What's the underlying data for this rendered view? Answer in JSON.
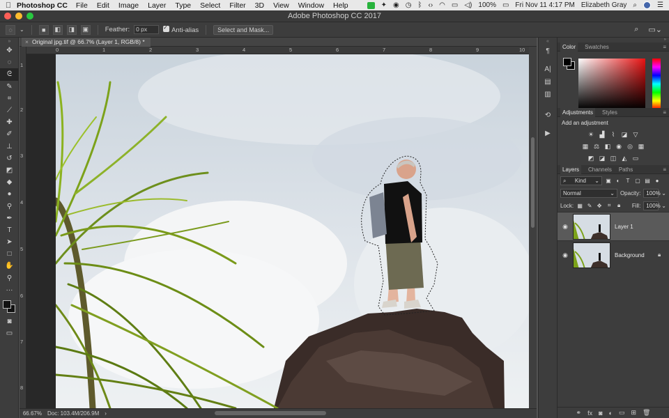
{
  "menubar": {
    "app_name": "Photoshop CC",
    "items": [
      "File",
      "Edit",
      "Image",
      "Layer",
      "Type",
      "Select",
      "Filter",
      "3D",
      "View",
      "Window",
      "Help"
    ],
    "battery": "100%",
    "datetime": "Fri Nov 11  4:17 PM",
    "user": "Elizabeth Gray"
  },
  "window": {
    "title": "Adobe Photoshop CC 2017"
  },
  "options_bar": {
    "feather_label": "Feather:",
    "feather_value": "0 px",
    "antialias_label": "Anti-alias",
    "antialias_checked": true,
    "select_mask_label": "Select and Mask..."
  },
  "document": {
    "tab_title": "Original jpg.tif @ 66.7% (Layer 1, RGB/8) *",
    "zoom": "66.67%",
    "doc_size": "Doc: 103.4M/206.9M",
    "ruler_top": [
      "0",
      "1",
      "2",
      "3",
      "4",
      "5",
      "6",
      "7",
      "8",
      "9",
      "10"
    ],
    "ruler_left": [
      "1",
      "2",
      "3",
      "4",
      "5",
      "6",
      "7",
      "8"
    ]
  },
  "color_panel": {
    "tabs": [
      "Color",
      "Swatches"
    ],
    "foreground": "#000000",
    "background": "#000000",
    "hue_color": "#e81212"
  },
  "adjustments_panel": {
    "tabs": [
      "Adjustments",
      "Styles"
    ],
    "label": "Add an adjustment"
  },
  "layers_panel": {
    "tabs": [
      "Layers",
      "Channels",
      "Paths"
    ],
    "filter_kind": "Kind",
    "blend_mode": "Normal",
    "opacity_label": "Opacity:",
    "opacity_value": "100%",
    "lock_label": "Lock:",
    "fill_label": "Fill:",
    "fill_value": "100%",
    "layers": [
      {
        "name": "Layer 1",
        "selected": true,
        "locked": false
      },
      {
        "name": "Background",
        "selected": false,
        "locked": true
      }
    ]
  }
}
